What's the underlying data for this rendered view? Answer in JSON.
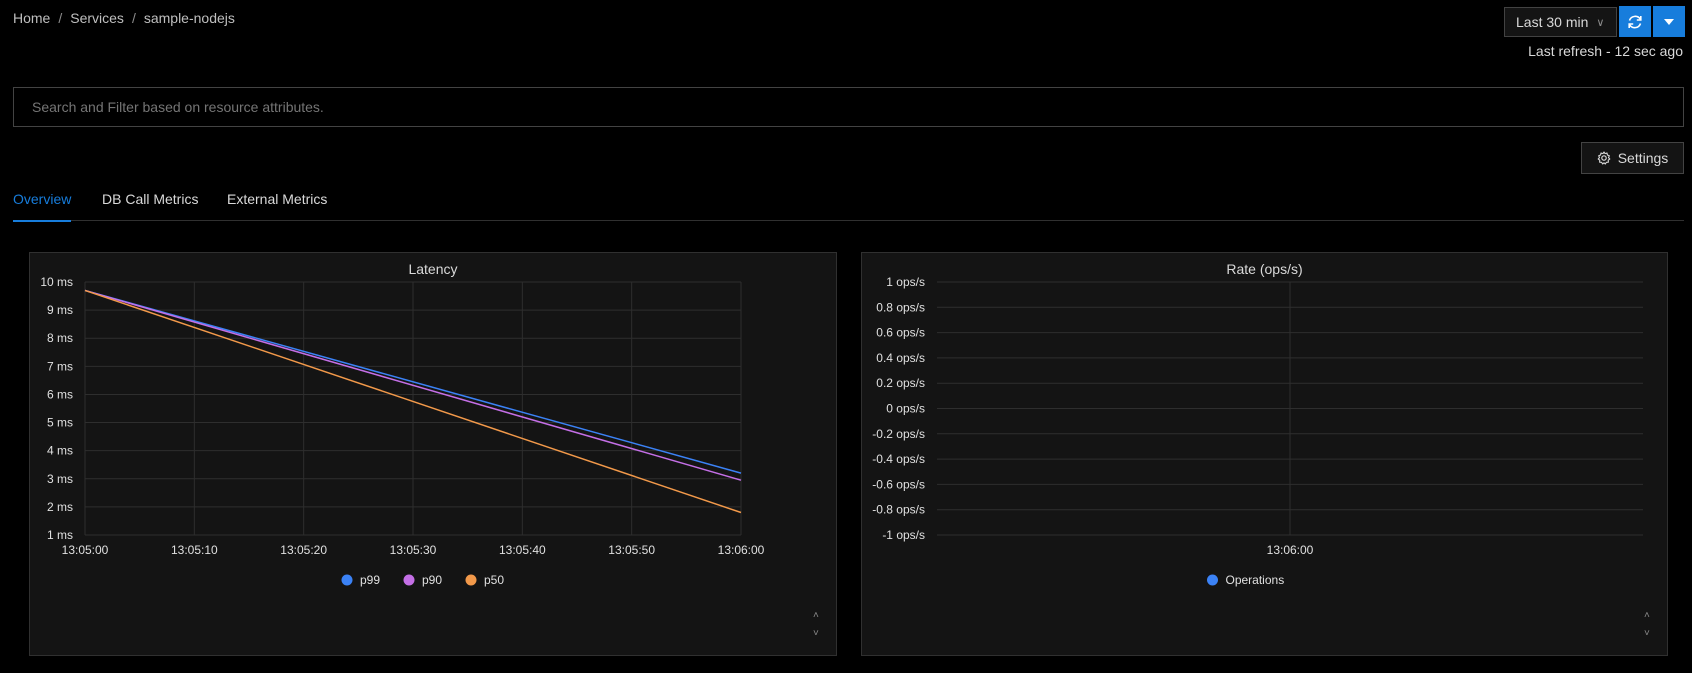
{
  "breadcrumb": {
    "home": "Home",
    "services": "Services",
    "current": "sample-nodejs",
    "separator": "/"
  },
  "header": {
    "time_range": "Last 30 min",
    "last_refresh": "Last refresh - 12 sec ago",
    "accent_color": "#177ddc"
  },
  "search": {
    "placeholder": "Search and Filter based on resource attributes."
  },
  "settings": {
    "label": "Settings"
  },
  "tabs": [
    {
      "label": "Overview",
      "active": true
    },
    {
      "label": "DB Call Metrics",
      "active": false
    },
    {
      "label": "External Metrics",
      "active": false
    }
  ],
  "chart_data": [
    {
      "type": "line",
      "title": "Latency",
      "x": [
        "13:05:00",
        "13:06:00"
      ],
      "x_ticks": [
        "13:05:00",
        "13:05:10",
        "13:05:20",
        "13:05:30",
        "13:05:40",
        "13:05:50",
        "13:06:00"
      ],
      "y_ticks": [
        "10 ms",
        "9 ms",
        "8 ms",
        "7 ms",
        "6 ms",
        "5 ms",
        "4 ms",
        "3 ms",
        "2 ms",
        "1 ms"
      ],
      "ylim": [
        1,
        10
      ],
      "series": [
        {
          "name": "p99",
          "color": "#3b82f6",
          "values": [
            9.7,
            3.2
          ]
        },
        {
          "name": "p90",
          "color": "#c46fe6",
          "values": [
            9.7,
            2.95
          ]
        },
        {
          "name": "p50",
          "color": "#f2994a",
          "values": [
            9.7,
            1.8
          ]
        }
      ],
      "legend": "bottom-center",
      "grid": true
    },
    {
      "type": "line",
      "title": "Rate (ops/s)",
      "x_ticks": [
        "13:06:00"
      ],
      "y_ticks": [
        "1 ops/s",
        "0.8 ops/s",
        "0.6 ops/s",
        "0.4 ops/s",
        "0.2 ops/s",
        "0 ops/s",
        "-0.2 ops/s",
        "-0.4 ops/s",
        "-0.6 ops/s",
        "-0.8 ops/s",
        "-1 ops/s"
      ],
      "ylim": [
        -1,
        1
      ],
      "series": [
        {
          "name": "Operations",
          "color": "#3b82f6",
          "values": []
        }
      ],
      "legend": "bottom-center",
      "grid": true
    }
  ]
}
